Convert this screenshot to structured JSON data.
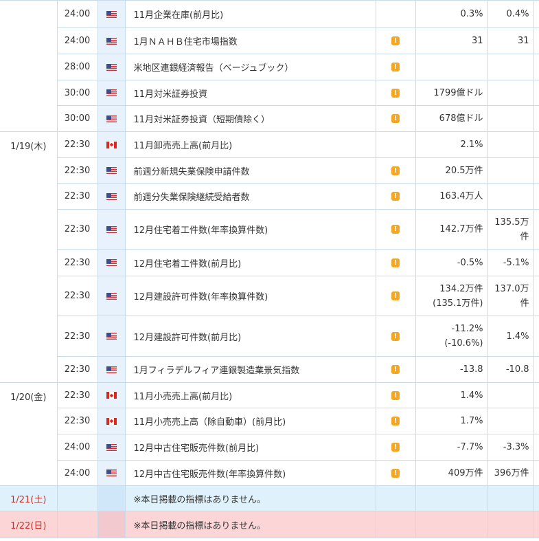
{
  "calendar": {
    "days": [
      {
        "date": "",
        "events": [
          {
            "time": "24:00",
            "country": "us",
            "flag_icon": "us-flag-icon",
            "name": "11月企業在庫(前月比)",
            "important": false,
            "previous": [
              "0.3%"
            ],
            "forecast": [
              "0.4%"
            ],
            "result": ""
          },
          {
            "time": "24:00",
            "country": "us",
            "flag_icon": "us-flag-icon",
            "name": "1月ＮＡＨＢ住宅市場指数",
            "important": true,
            "previous": [
              "31"
            ],
            "forecast": [
              "31"
            ],
            "result": ""
          },
          {
            "time": "28:00",
            "country": "us",
            "flag_icon": "us-flag-icon",
            "name": "米地区連銀経済報告（ベージュブック）",
            "important": true,
            "previous": [],
            "forecast": [],
            "result": ""
          },
          {
            "time": "30:00",
            "country": "us",
            "flag_icon": "us-flag-icon",
            "name": "11月対米証券投資",
            "important": true,
            "previous": [
              "1799億ドル"
            ],
            "forecast": [],
            "result": ""
          },
          {
            "time": "30:00",
            "country": "us",
            "flag_icon": "us-flag-icon",
            "name": "11月対米証券投資（短期債除く）",
            "important": true,
            "previous": [
              "678億ドル"
            ],
            "forecast": [],
            "result": ""
          }
        ]
      },
      {
        "date": "1/19(木)",
        "events": [
          {
            "time": "22:30",
            "country": "ca",
            "flag_icon": "canada-flag-icon",
            "name": "11月卸売売上高(前月比)",
            "important": false,
            "previous": [
              "2.1%"
            ],
            "forecast": [],
            "result": ""
          },
          {
            "time": "22:30",
            "country": "us",
            "flag_icon": "us-flag-icon",
            "name": "前週分新規失業保険申請件数",
            "important": true,
            "previous": [
              "20.5万件"
            ],
            "forecast": [],
            "result": ""
          },
          {
            "time": "22:30",
            "country": "us",
            "flag_icon": "us-flag-icon",
            "name": "前週分失業保険継続受給者数",
            "important": true,
            "previous": [
              "163.4万人"
            ],
            "forecast": [],
            "result": ""
          },
          {
            "time": "22:30",
            "country": "us",
            "flag_icon": "us-flag-icon",
            "name": "12月住宅着工件数(年率換算件数)",
            "important": true,
            "previous": [
              "142.7万件"
            ],
            "forecast": [
              "135.5万",
              "件"
            ],
            "result": ""
          },
          {
            "time": "22:30",
            "country": "us",
            "flag_icon": "us-flag-icon",
            "name": "12月住宅着工件数(前月比)",
            "important": true,
            "previous": [
              "-0.5%"
            ],
            "forecast": [
              "-5.1%"
            ],
            "result": ""
          },
          {
            "time": "22:30",
            "country": "us",
            "flag_icon": "us-flag-icon",
            "name": "12月建設許可件数(年率換算件数)",
            "important": true,
            "previous": [
              "134.2万件",
              "(135.1万件)"
            ],
            "forecast": [
              "137.0万",
              "件"
            ],
            "result": ""
          },
          {
            "time": "22:30",
            "country": "us",
            "flag_icon": "us-flag-icon",
            "name": "12月建設許可件数(前月比)",
            "important": true,
            "previous": [
              "-11.2%",
              "(-10.6%)"
            ],
            "forecast": [
              "1.4%"
            ],
            "result": ""
          },
          {
            "time": "22:30",
            "country": "us",
            "flag_icon": "us-flag-icon",
            "name": "1月フィラデルフィア連銀製造業景気指数",
            "important": true,
            "previous": [
              "-13.8"
            ],
            "forecast": [
              "-10.8"
            ],
            "result": ""
          }
        ]
      },
      {
        "date": "1/20(金)",
        "events": [
          {
            "time": "22:30",
            "country": "ca",
            "flag_icon": "canada-flag-icon",
            "name": "11月小売売上高(前月比)",
            "important": true,
            "previous": [
              "1.4%"
            ],
            "forecast": [],
            "result": ""
          },
          {
            "time": "22:30",
            "country": "ca",
            "flag_icon": "canada-flag-icon",
            "name": "11月小売売上高（除自動車）(前月比)",
            "important": true,
            "previous": [
              "1.7%"
            ],
            "forecast": [],
            "result": ""
          },
          {
            "time": "24:00",
            "country": "us",
            "flag_icon": "us-flag-icon",
            "name": "12月中古住宅販売件数(前月比)",
            "important": true,
            "previous": [
              "-7.7%"
            ],
            "forecast": [
              "-3.3%"
            ],
            "result": ""
          },
          {
            "time": "24:00",
            "country": "us",
            "flag_icon": "us-flag-icon",
            "name": "12月中古住宅販売件数(年率換算件数)",
            "important": true,
            "previous": [
              "409万件"
            ],
            "forecast": [
              "396万件"
            ],
            "result": ""
          }
        ]
      }
    ],
    "weekend": [
      {
        "date": "1/21(土)",
        "message": "※本日掲載の指標はありません。",
        "kind": "sat"
      },
      {
        "date": "1/22(日)",
        "message": "※本日掲載の指標はありません。",
        "kind": "sun"
      }
    ],
    "importance_icon_glyph": "!",
    "colors": {
      "grid_border": "#c9dbe9",
      "flag_column": "#e7f2fc",
      "saturday_row": "#dff1fa",
      "sunday_row": "#fcd6d6",
      "importance_icon": "#f5a623",
      "weekend_date_text": "#c9302c"
    }
  }
}
